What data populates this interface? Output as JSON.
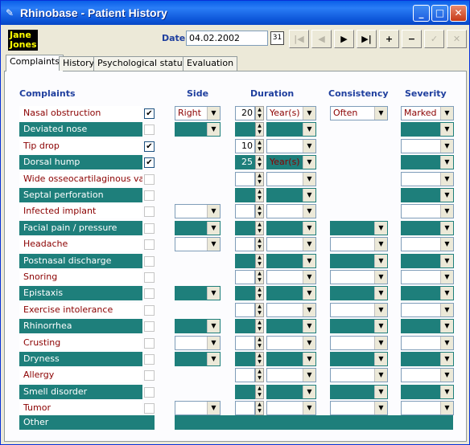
{
  "window": {
    "title": "Rhinobase  -  Patient History",
    "min": "_",
    "max": "□",
    "close": "✕"
  },
  "patient": {
    "first": "Jane",
    "last": "Jones"
  },
  "date": {
    "label": "Date",
    "value": "04.02.2002"
  },
  "nav": [
    "|◀",
    "◀",
    "▶",
    "▶|",
    "+",
    "−",
    "✓",
    "✕"
  ],
  "tabs": [
    "Complaints",
    "History",
    "Psychological status",
    "Evaluation"
  ],
  "headers": {
    "complaints": "Complaints",
    "side": "Side",
    "duration": "Duration",
    "consistency": "Consistency",
    "severity": "Severity"
  },
  "rows": [
    {
      "label": "Nasal obstruction",
      "checked": true,
      "side": "Right",
      "num": "20",
      "unit": "Year(s)",
      "consistency": "Often",
      "severity": "Marked"
    },
    {
      "label": "Deviated nose",
      "checked": false,
      "side": "",
      "num": "",
      "unit": "",
      "consistency": null,
      "severity": ""
    },
    {
      "label": "Tip drop",
      "checked": true,
      "side": null,
      "num": "10",
      "unit": "",
      "consistency": null,
      "severity": ""
    },
    {
      "label": "Dorsal hump",
      "checked": true,
      "side": null,
      "num": "25",
      "unit": "Year(s)",
      "consistency": null,
      "severity": ""
    },
    {
      "label": "Wide osseocartilaginous vault",
      "checked": false,
      "side": null,
      "num": "",
      "unit": "",
      "consistency": null,
      "severity": ""
    },
    {
      "label": "Septal perforation",
      "checked": false,
      "side": null,
      "num": "",
      "unit": "",
      "consistency": null,
      "severity": ""
    },
    {
      "label": "Infected implant",
      "checked": false,
      "side": "",
      "num": "",
      "unit": "",
      "consistency": null,
      "severity": ""
    },
    {
      "label": "Facial pain / pressure",
      "checked": false,
      "side": "",
      "num": "",
      "unit": "",
      "consistency": "",
      "severity": ""
    },
    {
      "label": "Headache",
      "checked": false,
      "side": "",
      "num": "",
      "unit": "",
      "consistency": "",
      "severity": ""
    },
    {
      "label": "Postnasal discharge",
      "checked": false,
      "side": null,
      "num": "",
      "unit": "",
      "consistency": "",
      "severity": ""
    },
    {
      "label": "Snoring",
      "checked": false,
      "side": null,
      "num": "",
      "unit": "",
      "consistency": "",
      "severity": ""
    },
    {
      "label": "Epistaxis",
      "checked": false,
      "side": "",
      "num": "",
      "unit": "",
      "consistency": "",
      "severity": ""
    },
    {
      "label": "Exercise intolerance",
      "checked": false,
      "side": null,
      "num": "",
      "unit": "",
      "consistency": "",
      "severity": ""
    },
    {
      "label": "Rhinorrhea",
      "checked": false,
      "side": "",
      "num": "",
      "unit": "",
      "consistency": "",
      "severity": ""
    },
    {
      "label": "Crusting",
      "checked": false,
      "side": "",
      "num": "",
      "unit": "",
      "consistency": "",
      "severity": ""
    },
    {
      "label": "Dryness",
      "checked": false,
      "side": "",
      "num": "",
      "unit": "",
      "consistency": "",
      "severity": ""
    },
    {
      "label": "Allergy",
      "checked": false,
      "side": null,
      "num": "",
      "unit": "",
      "consistency": "",
      "severity": ""
    },
    {
      "label": "Smell disorder",
      "checked": false,
      "side": null,
      "num": "",
      "unit": "",
      "consistency": "",
      "severity": ""
    },
    {
      "label": "Tumor",
      "checked": false,
      "side": "",
      "num": "",
      "unit": "",
      "consistency": "",
      "severity": ""
    }
  ],
  "other_label": "Other",
  "colors": {
    "teal": "#1e7f7b",
    "label_red": "#8b0000",
    "title_blue": "#0a5fe8"
  }
}
